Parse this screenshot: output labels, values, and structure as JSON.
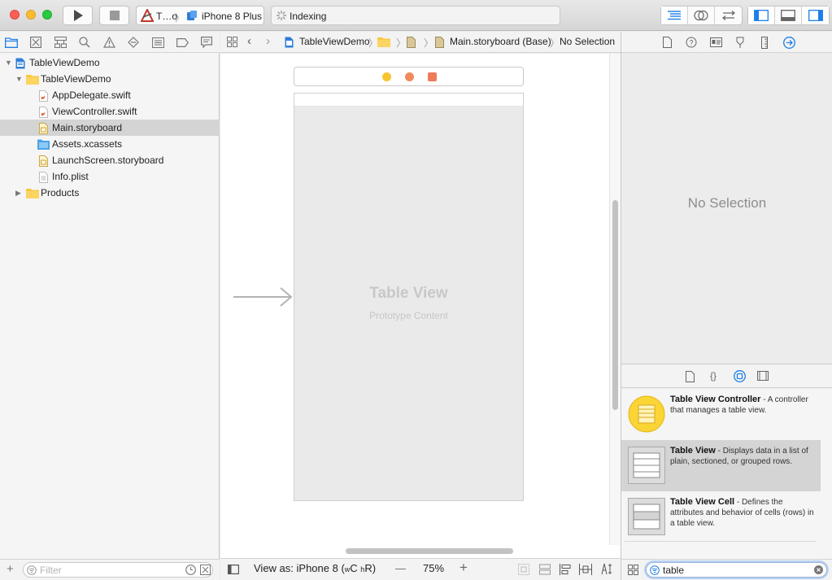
{
  "toolbar": {
    "scheme_name": "T…o",
    "device_name": "iPhone 8 Plus",
    "activity_text": "Indexing"
  },
  "navigator": {
    "filter_placeholder": "Filter",
    "tree": [
      {
        "label": "TableViewDemo",
        "icon": "project-icon",
        "expanded": true
      },
      {
        "label": "TableViewDemo",
        "icon": "folder-icon",
        "expanded": true
      },
      {
        "label": "AppDelegate.swift",
        "icon": "swift-file-icon"
      },
      {
        "label": "ViewController.swift",
        "icon": "swift-file-icon"
      },
      {
        "label": "Main.storyboard",
        "icon": "storyboard-file-icon",
        "selected": true
      },
      {
        "label": "Assets.xcassets",
        "icon": "asset-catalog-icon"
      },
      {
        "label": "LaunchScreen.storyboard",
        "icon": "storyboard-file-icon"
      },
      {
        "label": "Info.plist",
        "icon": "plist-file-icon"
      },
      {
        "label": "Products",
        "icon": "folder-icon",
        "expanded": false
      }
    ]
  },
  "jumpbar": {
    "project": "TableViewDemo",
    "file": "Main.storyboard (Base)",
    "selection": "No Selection"
  },
  "canvas": {
    "table_title": "Table View",
    "table_subtitle": "Prototype Content"
  },
  "editor_bottom": {
    "view_as_prefix": "View as: iPhone 8 (",
    "size_class_w": "w",
    "size_class_c": "C",
    "size_class_h": "h",
    "size_class_r": "R)",
    "zoom_minus": "—",
    "zoom": "75%",
    "zoom_plus": "+"
  },
  "inspector": {
    "empty_text": "No Selection"
  },
  "library": {
    "items": [
      {
        "title": "Table View Controller",
        "description": " - A controller that manages a table view."
      },
      {
        "title": "Table View",
        "description": " - Displays data in a list of plain, sectioned, or grouped rows."
      },
      {
        "title": "Table View Cell",
        "description": " - Defines the attributes and behavior of cells (rows) in a table view."
      }
    ],
    "filter_value": "table"
  },
  "colors": {
    "accent": "#1e7ee8",
    "selection": "#d4d4d4",
    "folder": "#f6c843",
    "yellow_thumb": "#fbd435"
  }
}
